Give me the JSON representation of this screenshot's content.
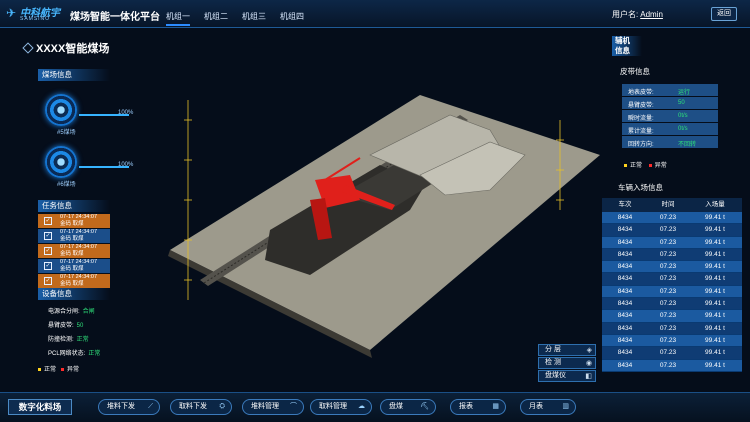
{
  "header": {
    "logo_text": "中科航宇",
    "logo_sub": "SAMSINO",
    "title": "煤场智能一体化平台",
    "tabs": [
      "机组一",
      "机组二",
      "机组三",
      "机组四"
    ],
    "user_label": "用户名:",
    "user_name": "Admin",
    "back_label": "返回"
  },
  "page_title": "XXXX智能煤场",
  "left": {
    "yard_info_title": "煤场信息",
    "yards": [
      {
        "label": "#5煤场",
        "percent_text": "100%",
        "fill": 1.0
      },
      {
        "label": "#6煤场",
        "percent_text": "100%",
        "fill": 1.0
      }
    ],
    "task_title": "任务信息",
    "tasks": [
      {
        "time": "07-17 24:34:07",
        "action": "金码",
        "status": "取煤"
      },
      {
        "time": "07-17 24:34:07",
        "action": "金码",
        "status": "取煤"
      },
      {
        "time": "07-17 24:34:07",
        "action": "金码",
        "status": "取煤"
      },
      {
        "time": "07-17 24:34:07",
        "action": "金码",
        "status": "取煤"
      },
      {
        "time": "07-17 24:34:07",
        "action": "金码",
        "status": "取煤"
      }
    ],
    "equip_title": "设备信息",
    "equipment": [
      {
        "key": "电源合分闸:",
        "value": "合闸"
      },
      {
        "key": "悬臂皮带:",
        "value": "50"
      },
      {
        "key": "防撞检测:",
        "value": "正常"
      },
      {
        "key": "PCL网络状态:",
        "value": "正常"
      }
    ],
    "legend": {
      "normal": "正常",
      "abnormal": "异常"
    }
  },
  "right": {
    "aux_title_1": "辅机",
    "aux_title_2": "信息",
    "belt_title": "皮带信息",
    "belts": [
      {
        "key": "地表皮带:",
        "value": "运行"
      },
      {
        "key": "悬臂皮带:",
        "value": "50"
      },
      {
        "key": "瞬时流量:",
        "value": "0t/s"
      },
      {
        "key": "累计流量:",
        "value": "0t/s"
      },
      {
        "key": "回转方向:",
        "value": "不回转"
      }
    ],
    "legend": {
      "normal": "正常",
      "abnormal": "异常"
    },
    "vehicle_title": "车辆入场信息",
    "vehicle_cols": [
      "车次",
      "时间",
      "入场量"
    ],
    "vehicles": [
      [
        "8434",
        "07.23",
        "99.41 t"
      ],
      [
        "8434",
        "07.23",
        "99.41 t"
      ],
      [
        "8434",
        "07.23",
        "99.41 t"
      ],
      [
        "8434",
        "07.23",
        "99.41 t"
      ],
      [
        "8434",
        "07.23",
        "99.41 t"
      ],
      [
        "8434",
        "07.23",
        "99.41 t"
      ],
      [
        "8434",
        "07.23",
        "99.41 t"
      ],
      [
        "8434",
        "07.23",
        "99.41 t"
      ],
      [
        "8434",
        "07.23",
        "99.41 t"
      ],
      [
        "8434",
        "07.23",
        "99.41 t"
      ],
      [
        "8434",
        "07.23",
        "99.41 t"
      ],
      [
        "8434",
        "07.23",
        "99.41 t"
      ],
      [
        "8434",
        "07.23",
        "99.41 t"
      ]
    ]
  },
  "scene_tools": [
    "分 层",
    "检 测",
    "盘煤仪"
  ],
  "bottom": {
    "title": "数字化料场",
    "buttons": [
      "堆料下发",
      "取料下发",
      "堆料管理",
      "取料管理",
      "盘煤",
      "报表",
      "月表"
    ]
  },
  "colors": {
    "accent": "#1a5fa8",
    "ok": "#2ee07a",
    "normal_dot": "#ffd21e",
    "abnormal_dot": "#ff2a2a",
    "stacker": "#e0201b"
  }
}
